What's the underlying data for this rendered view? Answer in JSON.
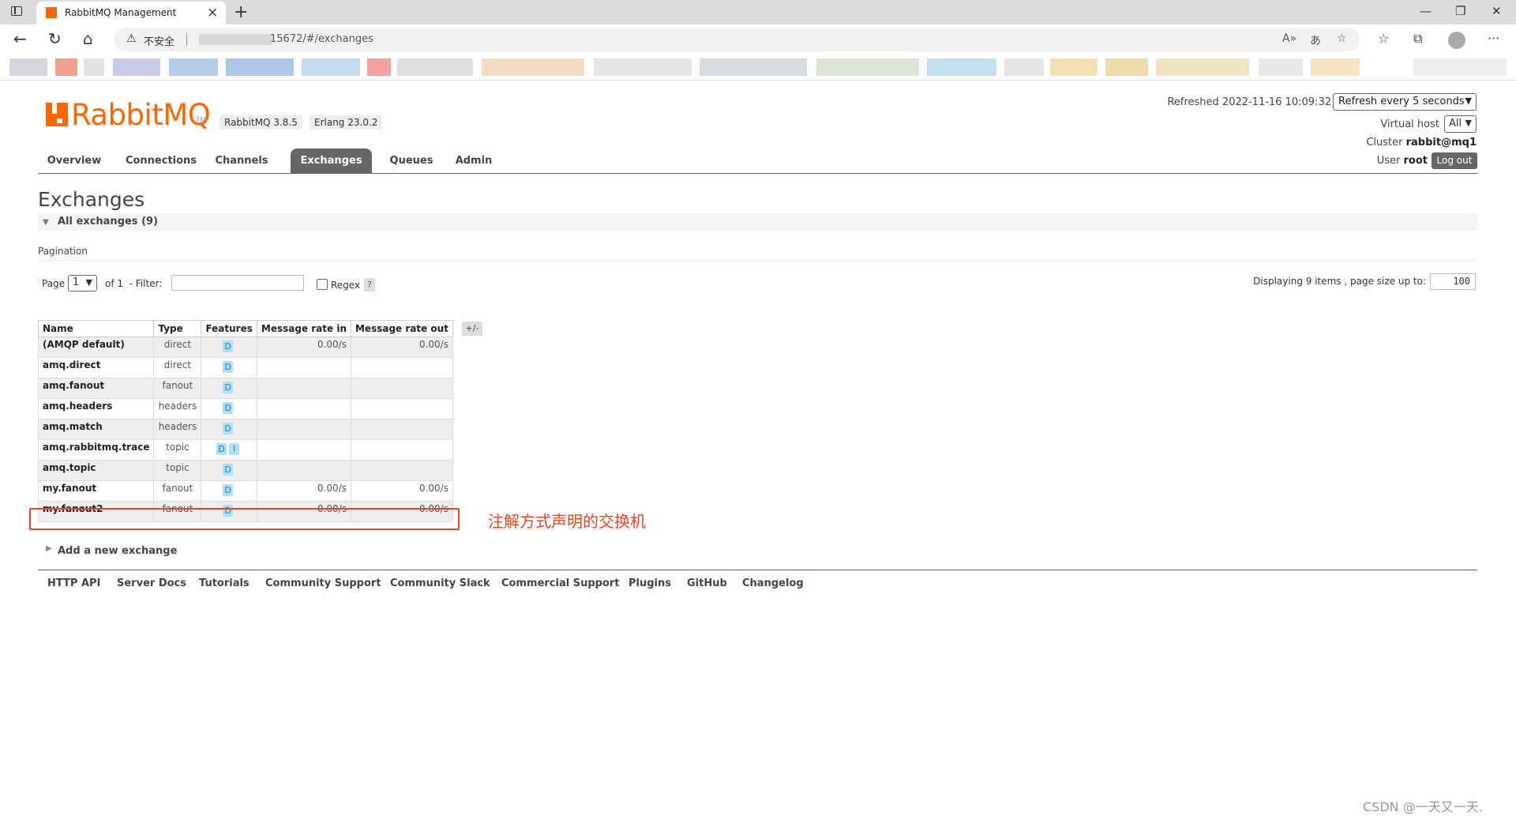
{
  "browser": {
    "tab_title": "RabbitMQ Management",
    "security_label": "不安全",
    "url": "15672/#/exchanges"
  },
  "header": {
    "version": "RabbitMQ 3.8.5",
    "erlang": "Erlang 23.0.2",
    "refreshed": "Refreshed 2022-11-16 10:09:32",
    "refresh_option": "Refresh every 5 seconds",
    "vhost_label": "Virtual host",
    "vhost_value": "All",
    "cluster_label": "Cluster",
    "cluster_value": "rabbit@mq1",
    "user_label": "User",
    "user_value": "root",
    "logout_label": "Log out"
  },
  "logo": {
    "text_a": "Rabbit",
    "text_b": "MQ",
    "tm": "TM"
  },
  "nav": [
    "Overview",
    "Connections",
    "Channels",
    "Exchanges",
    "Queues",
    "Admin"
  ],
  "page": {
    "title": "Exchanges",
    "section": "All exchanges (9)",
    "pagination_label": "Pagination",
    "page_label": "Page",
    "page_value": "1",
    "of_label": "of 1",
    "filter_label": "- Filter:",
    "regex_label": "Regex",
    "help": "?",
    "display_label": "Displaying 9 items , page size up to:",
    "page_size": "100",
    "plusminus": "+/-",
    "add_exchange": "Add a new exchange",
    "annotation": "注解方式声明的交换机"
  },
  "table": {
    "headers": [
      "Name",
      "Type",
      "Features",
      "Message rate in",
      "Message rate out"
    ],
    "rows": [
      {
        "name": "(AMQP default)",
        "type": "direct",
        "features": [
          "D"
        ],
        "rate_in": "0.00/s",
        "rate_out": "0.00/s"
      },
      {
        "name": "amq.direct",
        "type": "direct",
        "features": [
          "D"
        ],
        "rate_in": "",
        "rate_out": ""
      },
      {
        "name": "amq.fanout",
        "type": "fanout",
        "features": [
          "D"
        ],
        "rate_in": "",
        "rate_out": ""
      },
      {
        "name": "amq.headers",
        "type": "headers",
        "features": [
          "D"
        ],
        "rate_in": "",
        "rate_out": ""
      },
      {
        "name": "amq.match",
        "type": "headers",
        "features": [
          "D"
        ],
        "rate_in": "",
        "rate_out": ""
      },
      {
        "name": "amq.rabbitmq.trace",
        "type": "topic",
        "features": [
          "D",
          "I"
        ],
        "rate_in": "",
        "rate_out": ""
      },
      {
        "name": "amq.topic",
        "type": "topic",
        "features": [
          "D"
        ],
        "rate_in": "",
        "rate_out": ""
      },
      {
        "name": "my.fanout",
        "type": "fanout",
        "features": [
          "D"
        ],
        "rate_in": "0.00/s",
        "rate_out": "0.00/s"
      },
      {
        "name": "my.fanout2",
        "type": "fanout",
        "features": [
          "D"
        ],
        "rate_in": "0.00/s",
        "rate_out": "0.00/s"
      }
    ]
  },
  "footer": [
    "HTTP API",
    "Server Docs",
    "Tutorials",
    "Community Support",
    "Community Slack",
    "Commercial Support",
    "Plugins",
    "GitHub",
    "Changelog"
  ],
  "watermark": "CSDN @一天又一天.",
  "colors": {
    "brand": "#ff6600",
    "annotation": "#ee4422",
    "badge": "#aee0f7"
  }
}
